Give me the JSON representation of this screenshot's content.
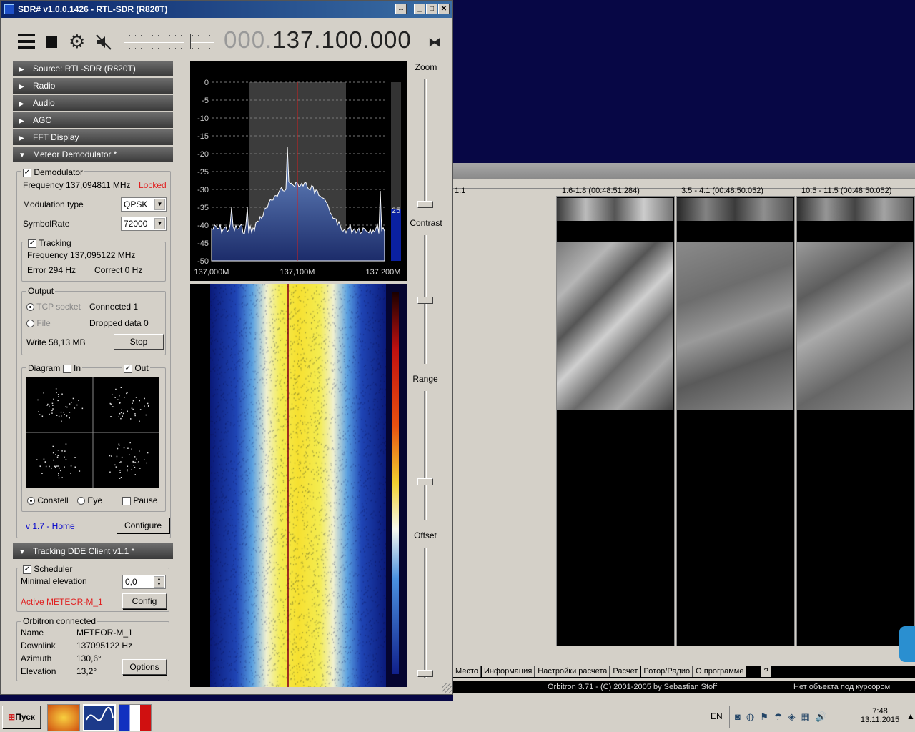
{
  "sdr": {
    "title": "SDR# v1.0.0.1426 - RTL-SDR (R820T)",
    "frequency_dim": "000.",
    "frequency_main": "137.100.000",
    "panels": [
      {
        "label": "Source: RTL-SDR (R820T)",
        "expanded": false
      },
      {
        "label": "Radio",
        "expanded": false
      },
      {
        "label": "Audio",
        "expanded": false
      },
      {
        "label": "AGC",
        "expanded": false
      },
      {
        "label": "FFT Display",
        "expanded": false
      },
      {
        "label": "Meteor Demodulator *",
        "expanded": true
      }
    ],
    "demod": {
      "demodulator_label": "Demodulator",
      "frequency_text": "Frequency 137,094811 MHz",
      "locked": "Locked",
      "modulation_label": "Modulation type",
      "modulation_value": "QPSK",
      "symbolrate_label": "SymbolRate",
      "symbolrate_value": "72000",
      "tracking_label": "Tracking",
      "tracking_freq": "Frequency 137,095122 MHz",
      "error": "Error 294 Hz",
      "correct": "Correct 0 Hz",
      "output_label": "Output",
      "tcp": "TCP socket",
      "connected": "Connected 1",
      "file": "File",
      "dropped": "Dropped data 0",
      "write": "Write 58,13 MB",
      "stop": "Stop",
      "diagram": "Diagram",
      "in": "In",
      "out": "Out",
      "constell": "Constell",
      "eye": "Eye",
      "pause": "Pause",
      "home_link": "v 1.7 - Home",
      "configure": "Configure"
    },
    "dde": {
      "header": "Tracking DDE Client v1.1 *",
      "scheduler": "Scheduler",
      "min_elev_label": "Minimal elevation",
      "min_elev_value": "0,0",
      "active": "Active METEOR-M_1",
      "config": "Config",
      "orbitron_label": "Orbitron connected",
      "name_label": "Name",
      "name_value": "METEOR-M_1",
      "downlink_label": "Downlink",
      "downlink_value": "137095122 Hz",
      "azimuth_label": "Azimuth",
      "azimuth_value": "130,6°",
      "elevation_label": "Elevation",
      "elevation_value": "13,2°",
      "options": "Options"
    },
    "spectrum": {
      "y_ticks": [
        "0",
        "-5",
        "-10",
        "-15",
        "-20",
        "-25",
        "-30",
        "-35",
        "-40",
        "-45",
        "-50"
      ],
      "x_ticks": [
        "137,000M",
        "137,100M",
        "137,200M"
      ],
      "level_label": "25"
    },
    "sliders": {
      "zoom": "Zoom",
      "contrast": "Contrast",
      "range": "Range",
      "offset": "Offset"
    }
  },
  "orbitron": {
    "col0": "1.1",
    "col1": "1.6-1.8 (00:48:51.284)",
    "col2": "3.5 - 4.1 (00:48:50.052)",
    "col3": "10.5 - 11.5 (00:48:50.052)",
    "tabs": [
      "Место",
      "Информация",
      "Настройки расчета",
      "Расчет",
      "Ротор/Радио",
      "О программе",
      "?"
    ],
    "status_left": "Orbitron 3.71 - (C) 2001-2005 by Sebastian Stoff",
    "status_right": "Нет объекта под курсором"
  },
  "taskbar": {
    "start": "Пуск",
    "lang": "EN",
    "time": "7:48",
    "date": "13.11.2015"
  }
}
